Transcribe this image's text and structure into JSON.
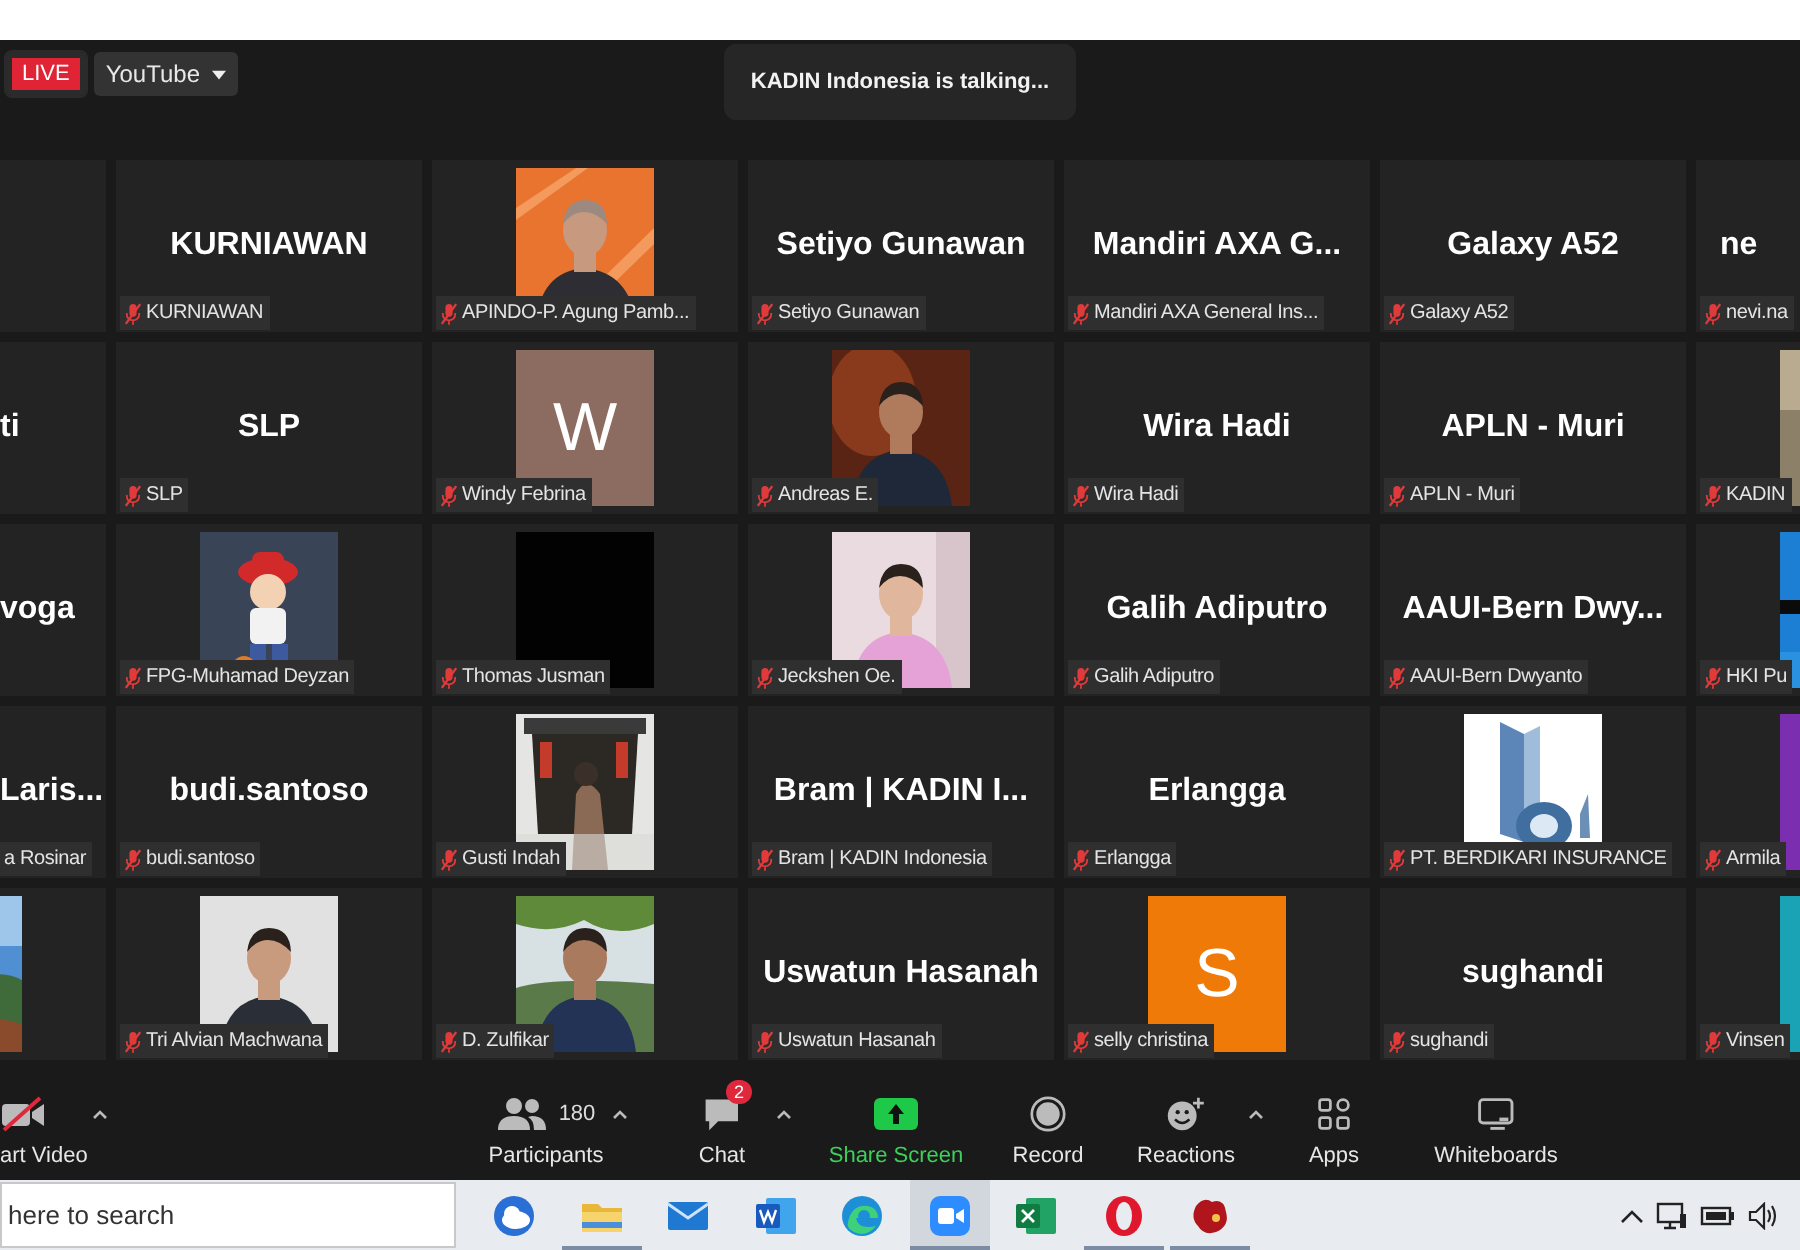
{
  "top_bar": {
    "live_badge": "LIVE",
    "stream_menu": "YouTube",
    "talking_banner": "KADIN Indonesia is talking..."
  },
  "gallery": {
    "rows": [
      {
        "tiles": [
          {
            "kind": "empty"
          },
          {
            "kind": "name",
            "title": "KURNIAWAN",
            "label": "KURNIAWAN",
            "muted": true
          },
          {
            "kind": "picture",
            "label": "APINDO-P. Agung Pamb...",
            "muted": true
          },
          {
            "kind": "name",
            "title": "Setiyo Gunawan",
            "label": "Setiyo Gunawan",
            "muted": true
          },
          {
            "kind": "name",
            "title": "Mandiri AXA G...",
            "label": "Mandiri AXA General Ins...",
            "muted": true
          },
          {
            "kind": "name",
            "title": "Galaxy A52",
            "label": "Galaxy A52",
            "muted": true
          },
          {
            "kind": "name",
            "title": "ne",
            "label": "nevi.na",
            "muted": true
          }
        ]
      },
      {
        "tiles": [
          {
            "kind": "name",
            "title": "ti"
          },
          {
            "kind": "name",
            "title": "SLP",
            "label": "SLP",
            "muted": true
          },
          {
            "kind": "avatar",
            "letter": "W",
            "color": "#8c6c60",
            "label": "Windy Febrina",
            "muted": true
          },
          {
            "kind": "picture",
            "label": "Andreas E.",
            "muted": true
          },
          {
            "kind": "name",
            "title": "Wira Hadi",
            "label": "Wira Hadi",
            "muted": true
          },
          {
            "kind": "name",
            "title": "APLN - Muri",
            "label": "APLN - Muri",
            "muted": true
          },
          {
            "kind": "picture",
            "label": "KADIN",
            "muted": true
          }
        ]
      },
      {
        "tiles": [
          {
            "kind": "name",
            "title": "voga"
          },
          {
            "kind": "picture",
            "label": "FPG-Muhamad Deyzan",
            "muted": true
          },
          {
            "kind": "blank",
            "label": "Thomas Jusman",
            "muted": true
          },
          {
            "kind": "picture",
            "label": "Jeckshen Oe.",
            "muted": true
          },
          {
            "kind": "name",
            "title": "Galih Adiputro",
            "label": "Galih Adiputro",
            "muted": true
          },
          {
            "kind": "name",
            "title": "AAUI-Bern Dwy...",
            "label": "AAUI-Bern Dwyanto",
            "muted": true
          },
          {
            "kind": "picture",
            "label": "HKI Pu",
            "muted": true
          }
        ]
      },
      {
        "tiles": [
          {
            "kind": "name",
            "title": "Laris...",
            "label": "a Rosinar"
          },
          {
            "kind": "name",
            "title": "budi.santoso",
            "label": "budi.santoso",
            "muted": true
          },
          {
            "kind": "picture",
            "label": "Gusti Indah",
            "muted": true
          },
          {
            "kind": "name",
            "title": "Bram | KADIN I...",
            "label": "Bram | KADIN Indonesia",
            "muted": true
          },
          {
            "kind": "name",
            "title": "Erlangga",
            "label": "Erlangga",
            "muted": true
          },
          {
            "kind": "picture",
            "label": "PT. BERDIKARI INSURANCE",
            "muted": true
          },
          {
            "kind": "avatar",
            "color": "#7b2fb0",
            "label": "Armila",
            "muted": true
          }
        ]
      },
      {
        "tiles": [
          {
            "kind": "picture"
          },
          {
            "kind": "picture",
            "label": "Tri Alvian Machwana",
            "muted": true
          },
          {
            "kind": "picture",
            "label": "D. Zulfikar",
            "muted": true
          },
          {
            "kind": "name",
            "title": "Uswatun Hasanah",
            "label": "Uswatun Hasanah",
            "muted": true
          },
          {
            "kind": "avatar",
            "letter": "S",
            "color": "#f07a08",
            "label": "selly christina",
            "muted": true
          },
          {
            "kind": "name",
            "title": "sughandi",
            "label": "sughandi",
            "muted": true
          },
          {
            "kind": "avatar",
            "color": "#1aa3b5",
            "label": "Vinsen",
            "muted": true
          }
        ]
      }
    ]
  },
  "toolbar": [
    {
      "kind": "video",
      "label": "art Video",
      "menu": true
    },
    {
      "kind": "participants",
      "label": "Participants",
      "count": "180",
      "menu": true
    },
    {
      "kind": "chat",
      "label": "Chat",
      "badge": "2",
      "menu": true
    },
    {
      "kind": "share",
      "label": "Share Screen",
      "menu": false
    },
    {
      "kind": "record",
      "label": "Record",
      "menu": false
    },
    {
      "kind": "reactions",
      "label": "Reactions",
      "menu": true
    },
    {
      "kind": "apps",
      "label": "Apps",
      "menu": false
    },
    {
      "kind": "whiteboards",
      "label": "Whiteboards",
      "menu": false
    }
  ],
  "taskbar": {
    "search": {
      "placeholder": "here to search"
    },
    "apps": [
      {
        "kind": "news",
        "active": false,
        "running": false
      },
      {
        "kind": "explorer",
        "active": false,
        "running": true
      },
      {
        "kind": "mail",
        "active": false,
        "running": false
      },
      {
        "kind": "word",
        "active": false,
        "running": false
      },
      {
        "kind": "edge",
        "active": false,
        "running": false
      },
      {
        "kind": "zoom",
        "active": true,
        "running": true
      },
      {
        "kind": "excel",
        "active": false,
        "running": false
      },
      {
        "kind": "opera",
        "active": false,
        "running": true
      },
      {
        "kind": "game",
        "active": false,
        "running": true
      }
    ]
  }
}
